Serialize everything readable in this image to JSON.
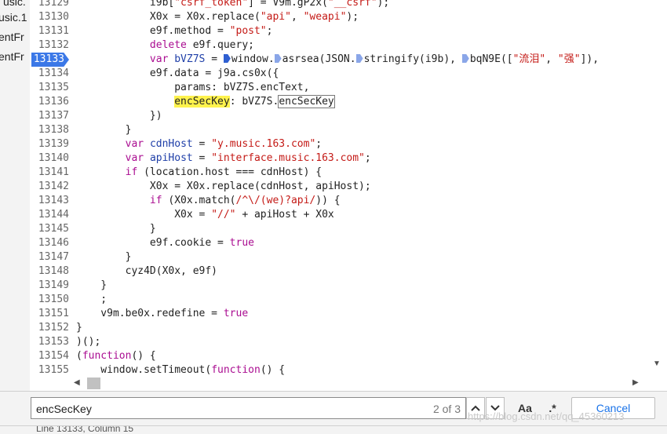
{
  "sidebar": {
    "items": [
      "usic.",
      "usic.1",
      "entFr",
      "entFr"
    ]
  },
  "editor": {
    "breakpoint_line": 13133,
    "lines": [
      {
        "n": "13129",
        "html": "            i9b[<span class=\"str\">\"csrf_token\"</span>] = V9m.gP2x(<span class=\"str\">\"__csrf\"</span>);"
      },
      {
        "n": "13130",
        "html": "            X0x = X0x.replace(<span class=\"str\">\"api\"</span>, <span class=\"str\">\"weapi\"</span>);"
      },
      {
        "n": "13131",
        "html": "            e9f.method = <span class=\"str\">\"post\"</span>;"
      },
      {
        "n": "13132",
        "html": "            <span class=\"kw\">delete</span> e9f.query;"
      },
      {
        "n": "13133",
        "html": "            <span class=\"kw\">var</span> <span class=\"var\">bVZ7S</span> = <span class=\"marker dark\"></span>window.<span class=\"marker\"></span>asrsea(JSON.<span class=\"marker\"></span>stringify(i9b), <span class=\"marker\"></span>bqN9E([<span class=\"str\">\"流泪\"</span>, <span class=\"str\">\"强\"</span>]),"
      },
      {
        "n": "13134",
        "html": "            e9f.data = j9a.cs0x({"
      },
      {
        "n": "13135",
        "html": "                params: bVZ7S.encText,"
      },
      {
        "n": "13136",
        "html": "                <span class=\"hl\">encSecKey</span>: bVZ7S.<span class=\"box\">encSecKey</span>"
      },
      {
        "n": "13137",
        "html": "            })"
      },
      {
        "n": "13138",
        "html": "        }"
      },
      {
        "n": "13139",
        "html": "        <span class=\"kw\">var</span> <span class=\"var\">cdnHost</span> = <span class=\"str\">\"y.music.163.com\"</span>;"
      },
      {
        "n": "13140",
        "html": "        <span class=\"kw\">var</span> <span class=\"var\">apiHost</span> = <span class=\"str\">\"interface.music.163.com\"</span>;"
      },
      {
        "n": "13141",
        "html": "        <span class=\"kw\">if</span> (location.host === cdnHost) {"
      },
      {
        "n": "13142",
        "html": "            X0x = X0x.replace(cdnHost, apiHost);"
      },
      {
        "n": "13143",
        "html": "            <span class=\"kw\">if</span> (X0x.match(<span class=\"str\">/^\\/(we)?api/</span>)) {"
      },
      {
        "n": "13144",
        "html": "                X0x = <span class=\"str\">\"//\"</span> + apiHost + X0x"
      },
      {
        "n": "13145",
        "html": "            }"
      },
      {
        "n": "13146",
        "html": "            e9f.cookie = <span class=\"kw\">true</span>"
      },
      {
        "n": "13147",
        "html": "        }"
      },
      {
        "n": "13148",
        "html": "        cyz4D(X0x, e9f)"
      },
      {
        "n": "13149",
        "html": "    }"
      },
      {
        "n": "13150",
        "html": "    ;"
      },
      {
        "n": "13151",
        "html": "    v9m.be0x.redefine = <span class=\"kw\">true</span>"
      },
      {
        "n": "13152",
        "html": "}"
      },
      {
        "n": "13153",
        "html": ")();"
      },
      {
        "n": "13154",
        "html": "(<span class=\"kw\">function</span>() {"
      },
      {
        "n": "13155",
        "html": "    window.setTimeout(<span class=\"kw\">function</span>() {"
      },
      {
        "n": "13156",
        "html": ""
      }
    ]
  },
  "search": {
    "query": "encSecKey",
    "match_count": "2 of 3",
    "case_label": "Aa",
    "regex_label": ".*",
    "cancel_label": "Cancel"
  },
  "watermark": "https://blog.csdn.net/qq_45360213",
  "status": "Line 13133, Column 15"
}
